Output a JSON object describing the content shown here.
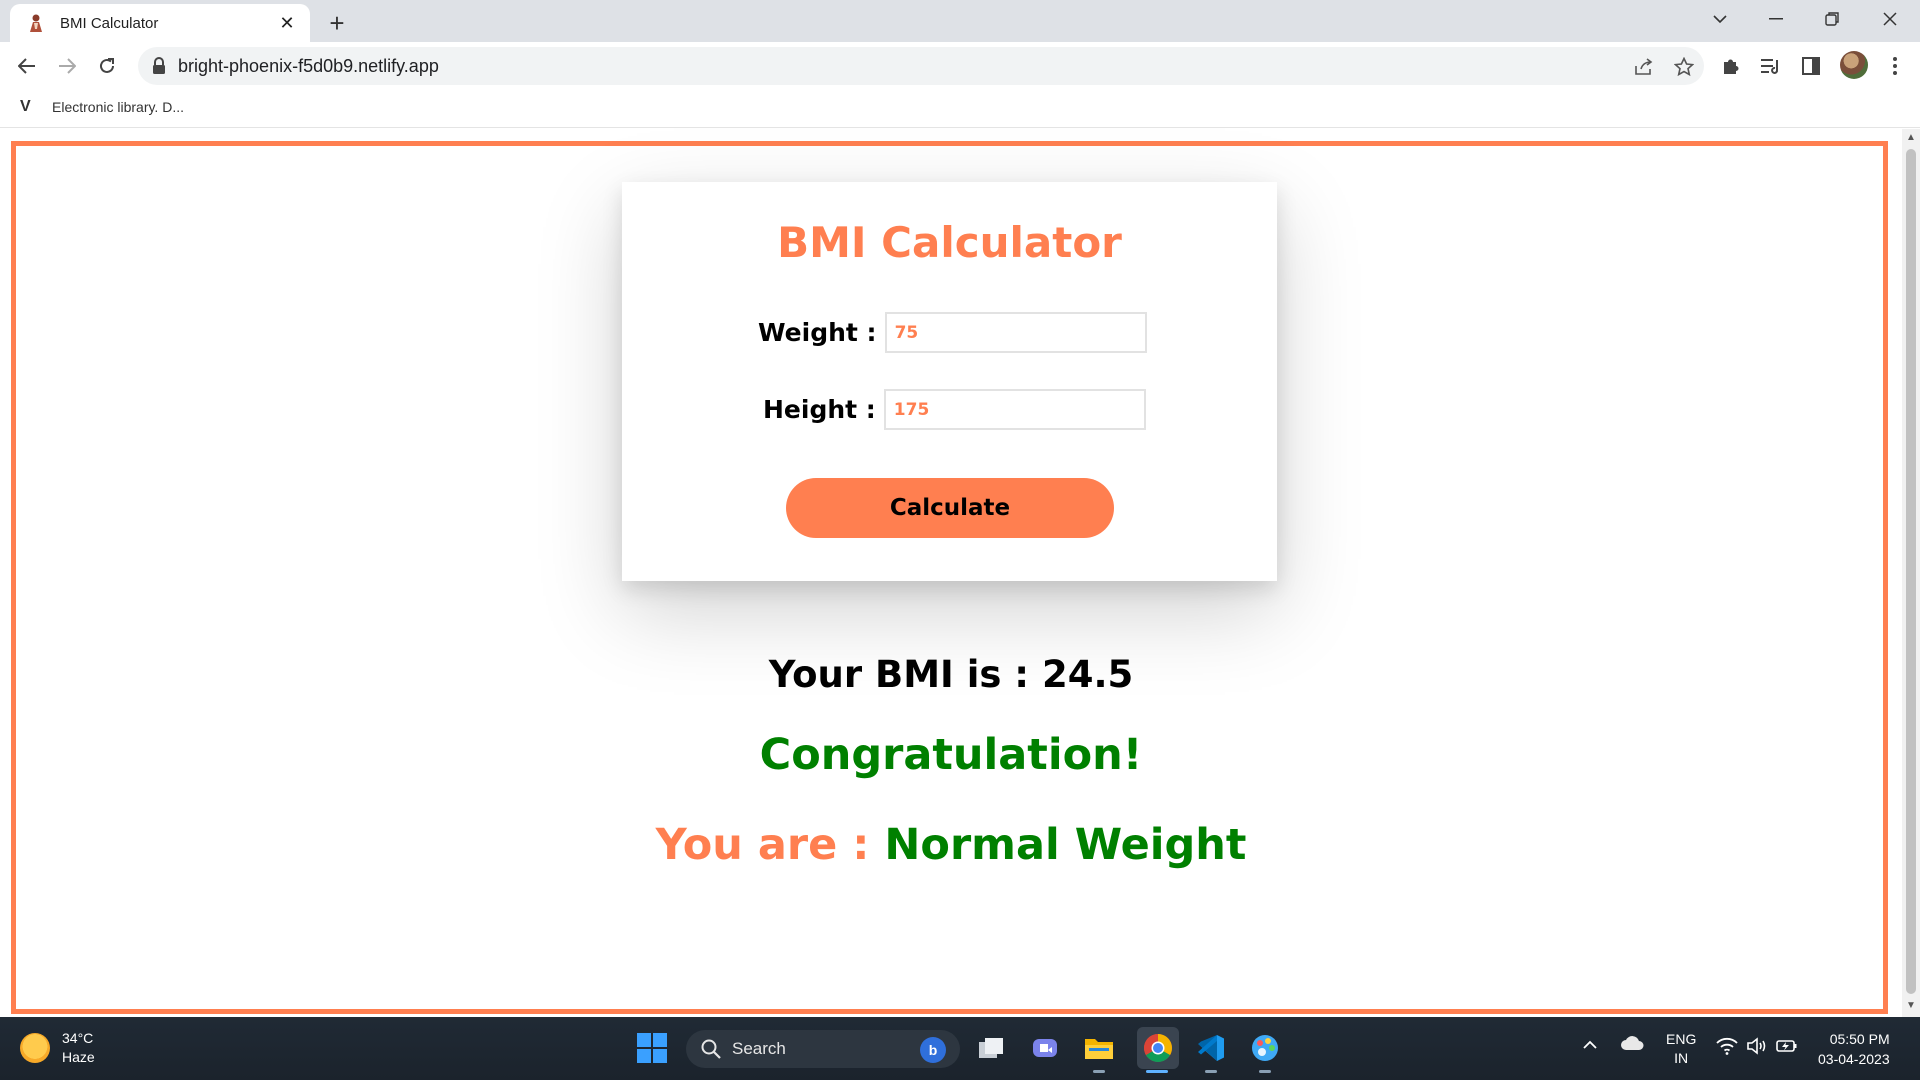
{
  "browser": {
    "tab_title": "BMI Calculator",
    "tab_close": "✕",
    "new_tab": "+",
    "url": "bright-phoenix-f5d0b9.netlify.app",
    "bookmark_label": "Electronic library. D...",
    "bookmark_icon": "V"
  },
  "app": {
    "title": "BMI Calculator",
    "weight_label": "Weight :",
    "weight_value": "75",
    "height_label": "Height :",
    "height_value": "175",
    "calculate_label": "Calculate",
    "bmi_text": "Your BMI is : 24.5",
    "message": "Congratulation!",
    "category_prefix": "You are :",
    "category_value": "Normal Weight",
    "accent_color": "#ff7f50",
    "success_color": "#008000"
  },
  "taskbar": {
    "temperature": "34°C",
    "condition": "Haze",
    "search_label": "Search",
    "language": "ENG",
    "region": "IN",
    "time": "05:50 PM",
    "date": "03-04-2023"
  }
}
